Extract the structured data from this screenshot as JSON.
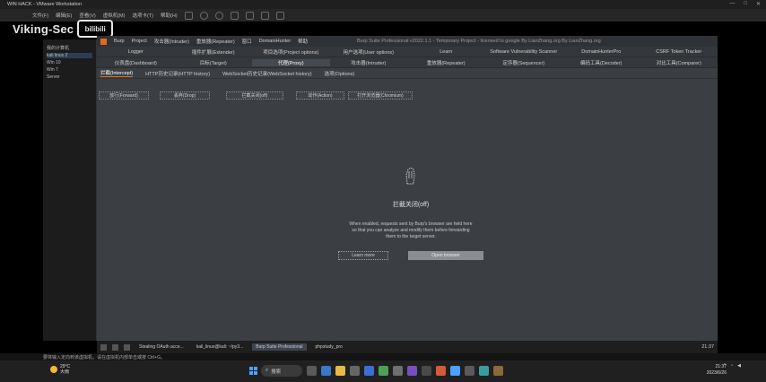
{
  "vmware": {
    "title": "WIN HACK - VMware Workstation",
    "menu": [
      "文件(F)",
      "编辑(E)",
      "查看(V)",
      "虚拟机(M)",
      "选项卡(T)",
      "帮助(H)"
    ],
    "controls": [
      "—",
      "□",
      "✕"
    ],
    "library": [
      "我的计算机",
      "kali linux 2",
      "Win 10",
      "Win 7",
      "Server"
    ],
    "status": "要将输入定向到该虚拟机，请在虚拟机内部单击或按 Ctrl+G。"
  },
  "watermark": {
    "text": "Viking-Sec",
    "logo": "bilibili"
  },
  "burp": {
    "menu": [
      "Burp",
      "Project",
      "攻击器(Intruder)",
      "重放器(Repeater)",
      "窗口",
      "DomainHunter",
      "帮助"
    ],
    "title": "Burp Suite Professional v2022.1.1 - Temporary Project - licensed to google By LianZhang.org By LianZhang.org",
    "tabs_row1": [
      "Logger",
      "插件扩展(Extender)",
      "项目选项(Project options)",
      "用户选项(User options)",
      "Learn",
      "Software Vulnerability Scanner",
      "DomainHunterPro",
      "CSRF Token Tracker"
    ],
    "tabs_row2": [
      "仪表盘(Dashboard)",
      "目标(Target)",
      "代理(Proxy)",
      "攻击器(Intruder)",
      "重放器(Repeater)",
      "定序器(Sequencer)",
      "编码工具(Decoder)",
      "对比工具(Comparer)"
    ],
    "tabs_row2_active": 2,
    "subtabs": [
      "拦截(Intercept)",
      "HTTP历史记录(HTTP history)",
      "WebSocket历史记录(WebSocket history)",
      "选项(Options)"
    ],
    "actions": {
      "forward": "放行(Forward)",
      "drop": "丢弃(Drop)",
      "intercept": "拦截关闭(off)",
      "action": "动作(Action)",
      "open_browser": "打开浏览器(Chromium)"
    },
    "center": {
      "title": "拦截关闭(off)",
      "desc1": "When enabled, requests sent by Burp's browser are held here",
      "desc2": "so that you can analyze and modify them before forwarding",
      "desc3": "them to the target server.",
      "learn_more": "Learn more",
      "open_browser": "Open browser"
    }
  },
  "vm_taskbar": {
    "tasks": [
      "Stealing OAuth acce...",
      "kali_linux@kali: ~/py3...",
      "Burp Suite Professional",
      "phpstudy_pro"
    ],
    "active_index": 2,
    "time": "21:37"
  },
  "windows": {
    "weather_temp": "29°C",
    "weather_desc": "大雨",
    "search": "搜索",
    "time": "21:37",
    "date": "2023/6/26",
    "colors": {
      "start": "#4aa3ff",
      "burp_orange": "#e8681b"
    }
  }
}
